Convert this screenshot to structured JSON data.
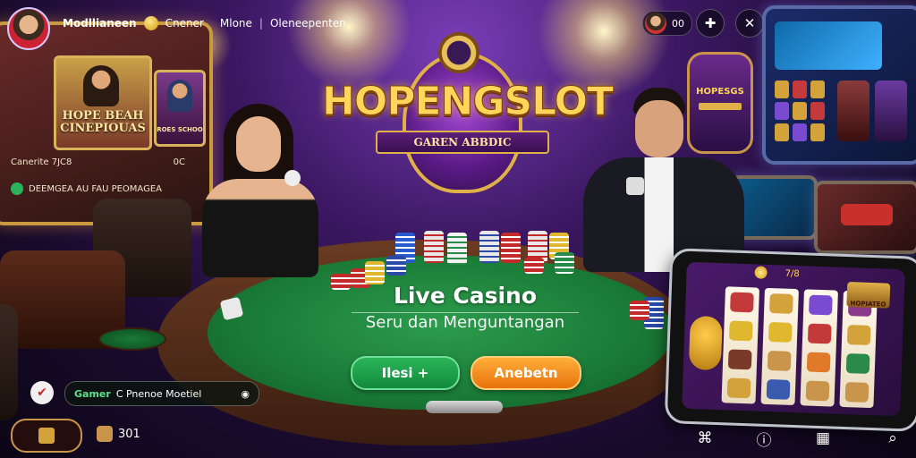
{
  "header": {
    "username": "Modllianeen",
    "nav_items": [
      "Cnener",
      "Mlone",
      "Oleneepenten"
    ],
    "avatar_count": "00",
    "coin_balance": "00"
  },
  "billboard": {
    "poster_title": "HOPE BEAH CINEPIOUAS",
    "poster_small_label": "ROES SCHOO",
    "game_line": "Canerite 7JC8",
    "game_line_tag": "0C",
    "promo_line": "DEEMGEA AU FAU PEOMAGEA"
  },
  "logo": {
    "title": "HOPENGSLOT",
    "subtitle": "GAREN ABBDIC"
  },
  "wall": {
    "sign_title": "HOPESGS"
  },
  "table": {
    "title": "Live Casino",
    "subtitle": "Seru dan Menguntangan",
    "btn_primary": "Ilesi +",
    "btn_secondary": "Anebetn"
  },
  "bottom": {
    "gamer_label": "Gamer",
    "gamer_text": "C Pnenoe Moetiel",
    "stat_value": "301"
  },
  "phone": {
    "screen_label": "7/8",
    "banner_label": "HOPIATEO"
  },
  "icons": [
    "puzzle-icon",
    "close-icon",
    "menu-icon",
    "shield-icon",
    "info-icon",
    "grid-icon",
    "search-icon",
    "cash-icon"
  ]
}
